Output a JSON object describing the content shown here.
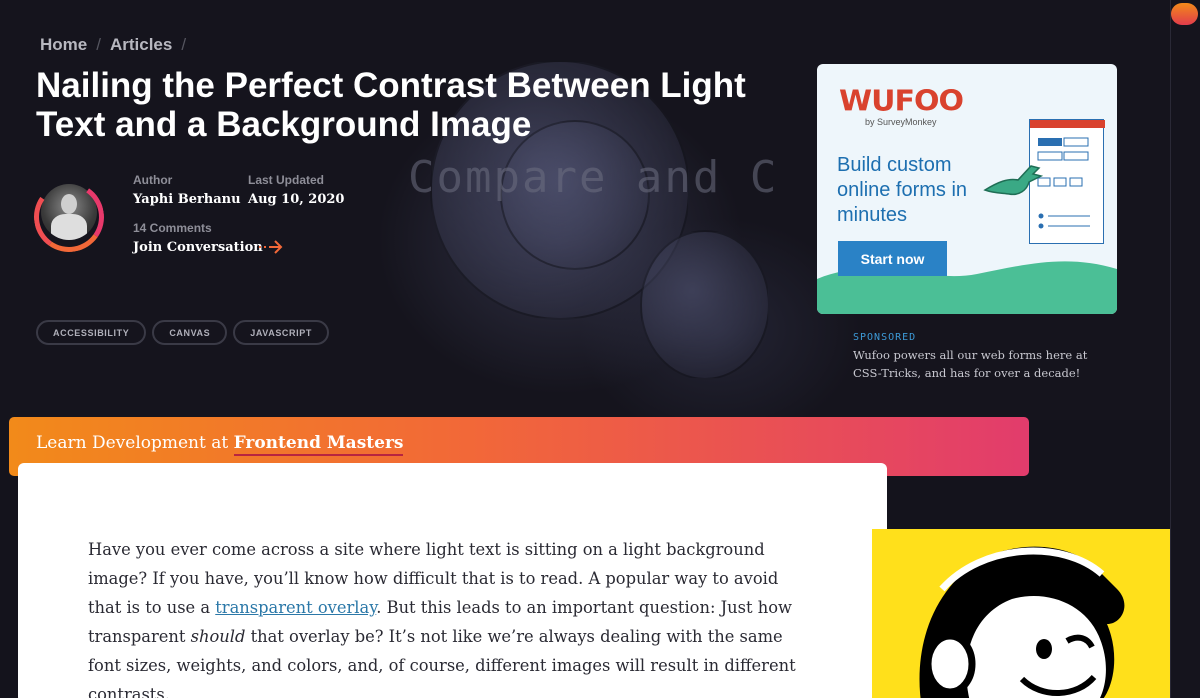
{
  "breadcrumb": {
    "home": "Home",
    "separator": "/",
    "articles": "Articles"
  },
  "hero": {
    "overlay_text": "Compare and C"
  },
  "article": {
    "title": "Nailing the Perfect Contrast Between Light Text and a Background Image",
    "author_label": "Author",
    "author_name": "Yaphi Berhanu",
    "updated_label": "Last Updated",
    "updated_date": "Aug 10, 2020",
    "comments_label": "14 Comments",
    "join_label": "Join Conversation",
    "tags": [
      "ACCESSIBILITY",
      "CANVAS",
      "JAVASCRIPT"
    ],
    "body_before_link": "Have you ever come across a site where light text is sitting on a light background image? If you have, you’ll know how difficult that is to read. A popular way to avoid that is to use a ",
    "body_link": "transparent overlay",
    "body_mid": ". But this leads to an important question: Just how transparent ",
    "body_em": "should",
    "body_after": " that overlay be? It’s not like we’re always dealing with the same font sizes, weights, and colors, and, of course, different images will result in different contrasts."
  },
  "ad": {
    "logo": "WUFOO",
    "logo_sub": "by SurveyMonkey",
    "headline": "Build custom online forms in minutes",
    "cta": "Start now",
    "sponsored_label": "SPONSORED",
    "sponsor_text": "Wufoo powers all our web forms here at CSS-Tricks, and has for over a decade!"
  },
  "banner": {
    "prefix": "Learn Development at ",
    "brand": "Frontend Masters"
  },
  "colors": {
    "accent_orange": "#f26838",
    "accent_pink": "#e23c6c",
    "link": "#2b78a8",
    "mailchimp_yellow": "#ffe01b"
  }
}
